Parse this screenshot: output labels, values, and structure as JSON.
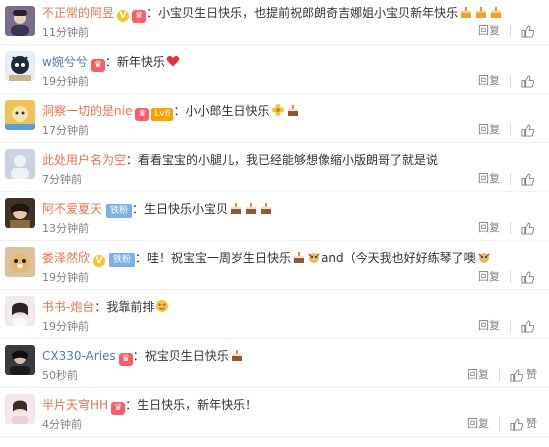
{
  "comments": [
    {
      "user": "不正常的阿昱",
      "badges": [
        "V",
        "vip"
      ],
      "text": "小宝贝生日快乐，也提前祝郎朗奇吉娜姐小宝贝新年快乐",
      "emoji": [
        "cake-icon",
        "cake-icon",
        "cake-icon"
      ],
      "time": "11分钟前",
      "reply": "回复",
      "like": ""
    },
    {
      "user": "w婉兮兮",
      "badges": [
        "vip"
      ],
      "text": "新年快乐",
      "emoji": [
        "heart-icon"
      ],
      "time": "19分钟前",
      "reply": "回复",
      "like": ""
    },
    {
      "user": "洞察一切的是nie",
      "badges": [
        "vip-lv"
      ],
      "lv": "Lv6",
      "text": "小小郎生日快乐",
      "emoji": [
        "flower-icon",
        "cake-icon"
      ],
      "time": "17分钟前",
      "reply": "回复",
      "like": ""
    },
    {
      "user": "此处用户名为空",
      "badges": [],
      "text": "看看宝宝的小腿儿，我已经能够想像缩小版朗哥了就是说",
      "emoji": [],
      "time": "7分钟前",
      "reply": "回复",
      "like": ""
    },
    {
      "user": "阿不爱夏天",
      "badges": [
        "fan"
      ],
      "fan": "铁粉",
      "text": "生日快乐小宝贝",
      "emoji": [
        "cake-icon",
        "cake-icon",
        "cake-icon"
      ],
      "time": "13分钟前",
      "reply": "回复",
      "like": ""
    },
    {
      "user": "娄泽然欣",
      "badges": [
        "V",
        "fan"
      ],
      "fan": "铁粉",
      "text": "哇！祝宝宝一周岁生日快乐",
      "text2": "and（今天我也好好练琴了噢",
      "emoji": [
        "cake-icon",
        "dog-icon"
      ],
      "time": "19分钟前",
      "reply": "回复",
      "like": ""
    },
    {
      "user": "书书-炮台",
      "badges": [],
      "text": "我靠前排",
      "emoji": [
        "love-face-icon"
      ],
      "time": "19分钟前",
      "reply": "回复",
      "like": ""
    },
    {
      "user": "CX330-Aries",
      "badges": [
        "vip"
      ],
      "text": "祝宝贝生日快乐",
      "emoji": [
        "cake-icon"
      ],
      "time": "50秒前",
      "reply": "回复",
      "like": "赞"
    },
    {
      "user": "半片天穹HH",
      "badges": [
        "vip"
      ],
      "text": "生日快乐，新年快乐！",
      "emoji": [],
      "time": "4分钟前",
      "reply": "回复",
      "like": "赞"
    }
  ],
  "colors": {
    "username": "#eb7350",
    "username_alt": "#507daf",
    "meta": "#808080",
    "vip": "#f65e6a",
    "v_badge": "#f8c22b",
    "fan_badge": "#7eb0e8"
  }
}
